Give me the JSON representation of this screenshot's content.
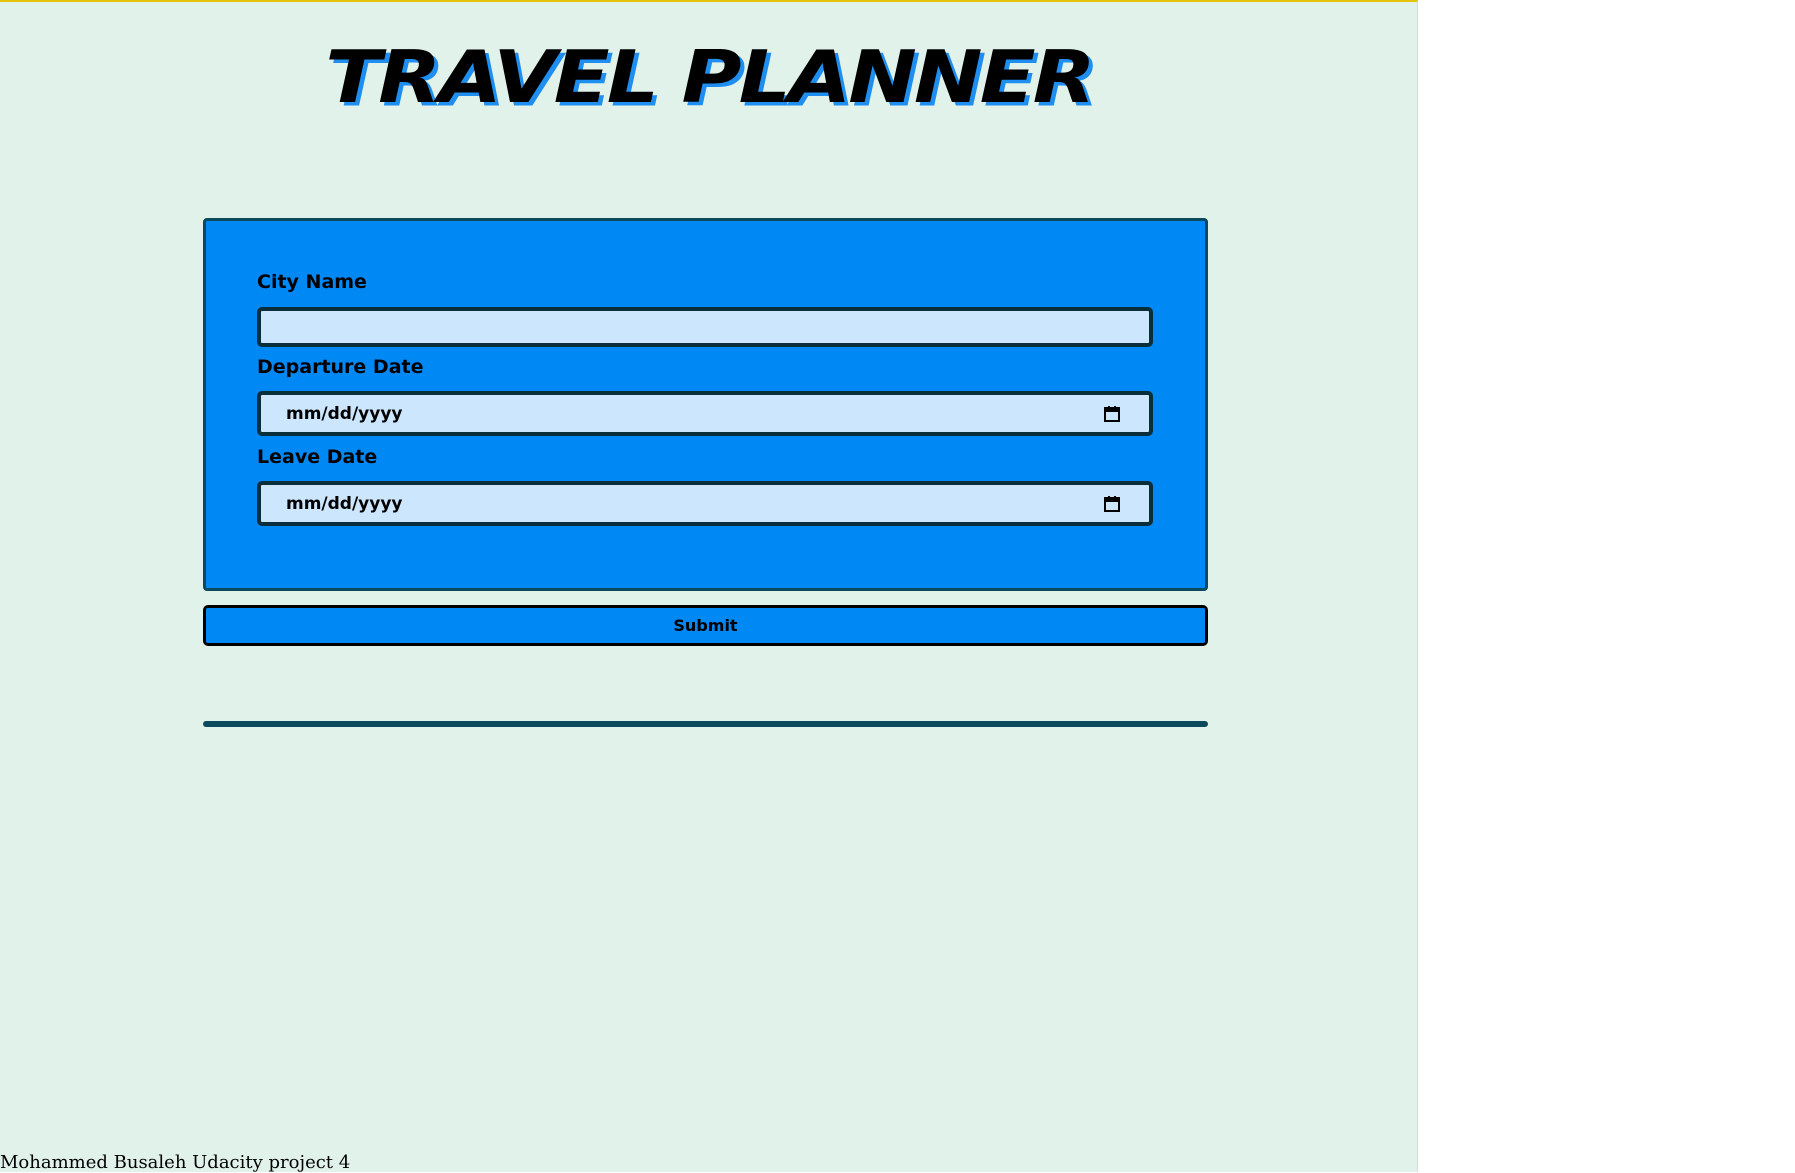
{
  "header": {
    "title": "Travel Planner"
  },
  "form": {
    "city": {
      "label": "City Name",
      "value": ""
    },
    "departure": {
      "label": "Departure Date",
      "placeholder": "mm/dd/yyyy",
      "icon": "calendar-icon"
    },
    "leave": {
      "label": "Leave Date",
      "placeholder": "mm/dd/yyyy",
      "icon": "calendar-icon"
    },
    "submit_label": "Submit"
  },
  "footer": {
    "text": "Mohammed Busaleh Udacity project 4"
  },
  "colors": {
    "page_background": "#e1f2eb",
    "top_accent": "#e3c40b",
    "card_background": "#0088f5",
    "card_border": "#0b4a5c",
    "input_background": "#cbe6fd",
    "title_shadow": "#1e8ff0"
  }
}
